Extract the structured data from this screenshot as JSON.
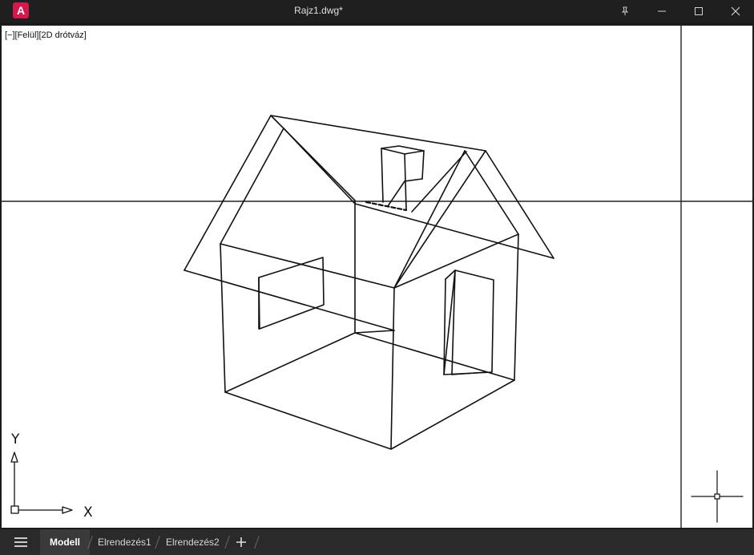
{
  "window": {
    "app_logo": "A",
    "title": "Rajz1.dwg*",
    "icons": [
      "pin-icon",
      "minimize-icon",
      "maximize-icon",
      "close-icon"
    ]
  },
  "viewport": {
    "controls_label": "[−][Felül][2D drótváz]",
    "ucs": {
      "x_label": "X",
      "y_label": "Y"
    },
    "background": "#ffffff",
    "line_color": "#000000"
  },
  "tabs": {
    "model": "Modell",
    "layout1": "Elrendezés1",
    "layout2": "Elrendezés2"
  },
  "colors": {
    "brand": "#d6194a",
    "titlebar": "#1f1f1f",
    "tabbar": "#2a2a2a",
    "active_tab": "#3a3a3a"
  }
}
